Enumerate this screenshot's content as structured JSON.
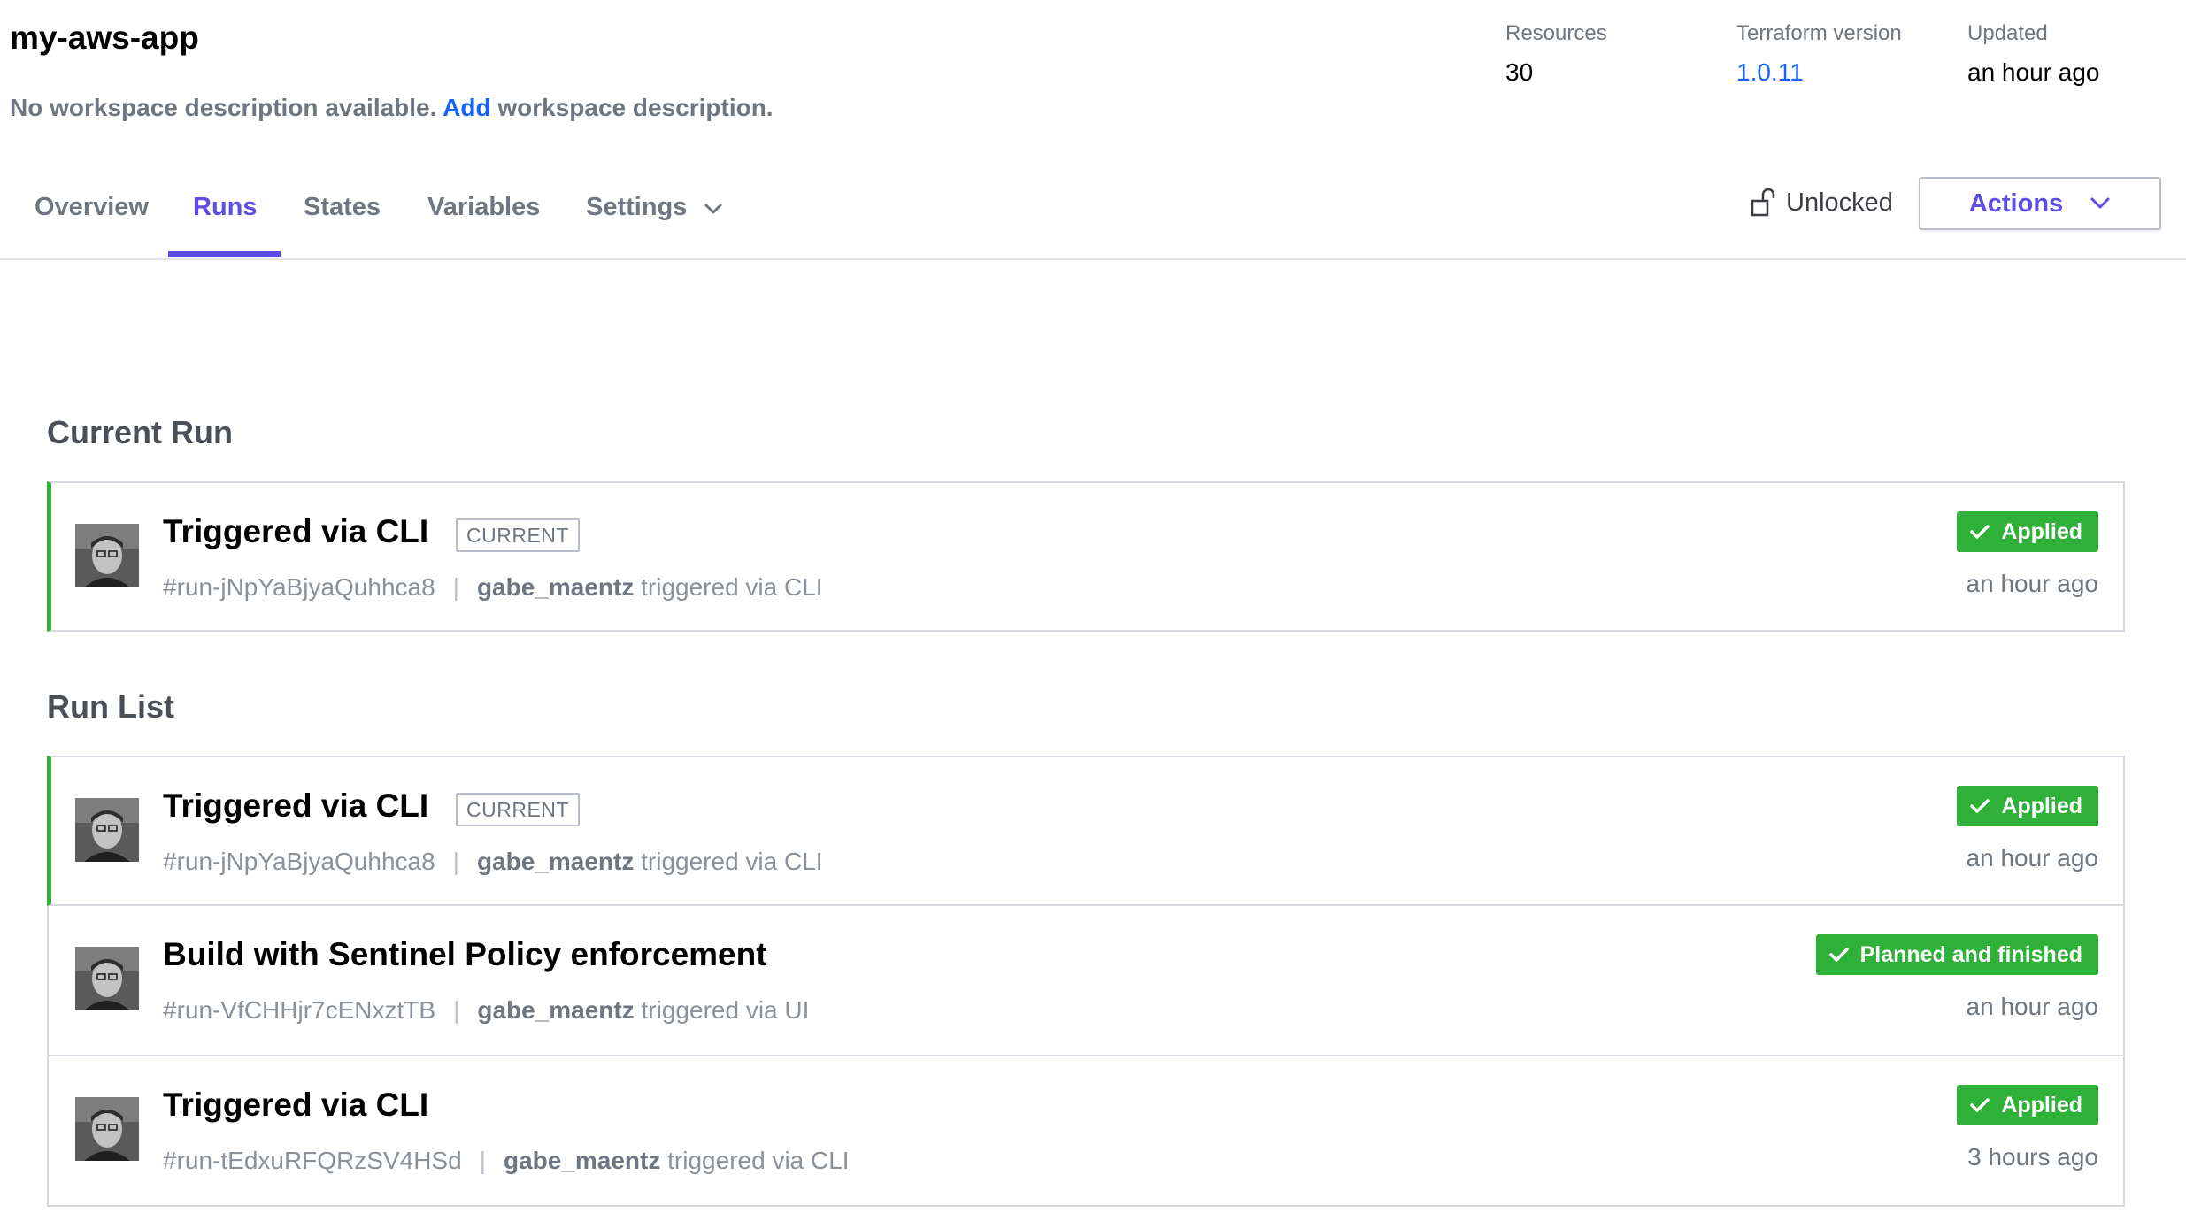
{
  "workspace": {
    "name": "my-aws-app",
    "description_prefix": "No workspace description available.",
    "description_link": "Add",
    "description_suffix": "workspace description."
  },
  "meta": {
    "resources_label": "Resources",
    "resources_value": "30",
    "terraform_label": "Terraform version",
    "terraform_value": "1.0.11",
    "updated_label": "Updated",
    "updated_value": "an hour ago"
  },
  "tabs": [
    {
      "label": "Overview",
      "active": false
    },
    {
      "label": "Runs",
      "active": true
    },
    {
      "label": "States",
      "active": false
    },
    {
      "label": "Variables",
      "active": false
    },
    {
      "label": "Settings",
      "active": false
    }
  ],
  "lock_status": "Unlocked",
  "actions_label": "Actions",
  "sections": {
    "current_run": "Current Run",
    "run_list": "Run List"
  },
  "current_run": {
    "title": "Triggered via CLI",
    "tag": "CURRENT",
    "run_id": "#run-jNpYaBjyaQuhhca8",
    "user": "gabe_maentz",
    "via": "triggered via CLI",
    "status": "Applied",
    "time": "an hour ago"
  },
  "runs": [
    {
      "title": "Triggered via CLI",
      "tag": "CURRENT",
      "run_id": "#run-jNpYaBjyaQuhhca8",
      "user": "gabe_maentz",
      "via": "triggered via CLI",
      "status": "Applied",
      "time": "an hour ago"
    },
    {
      "title": "Build with Sentinel Policy enforcement",
      "tag": "",
      "run_id": "#run-VfCHHjr7cENxztTB",
      "user": "gabe_maentz",
      "via": "triggered via UI",
      "status": "Planned and finished",
      "time": "an hour ago"
    },
    {
      "title": "Triggered via CLI",
      "tag": "",
      "run_id": "#run-tEdxuRFQRzSV4HSd",
      "user": "gabe_maentz",
      "via": "triggered via CLI",
      "status": "Applied",
      "time": "3 hours ago"
    }
  ],
  "colors": {
    "accent": "#5c4ee5",
    "link": "#1563ff",
    "success": "#2eb039",
    "muted": "#6f7682"
  }
}
